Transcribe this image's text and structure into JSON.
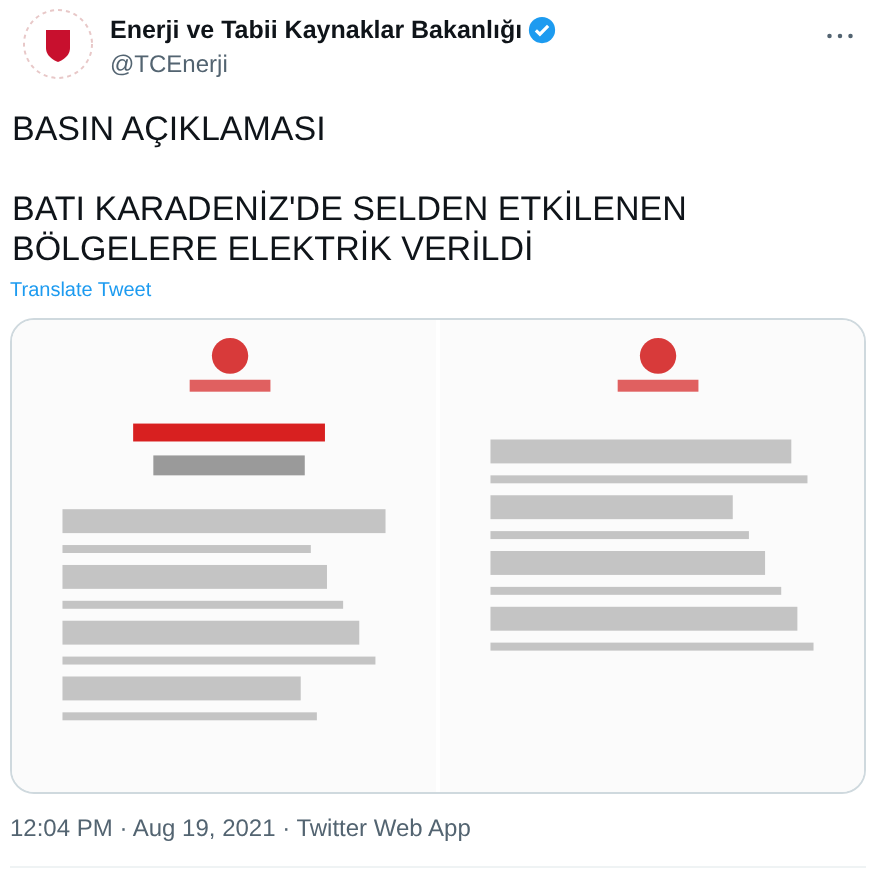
{
  "author": {
    "name": "Enerji ve Tabii Kaynaklar Bakanlığı",
    "verified": true,
    "handle": "@TCEnerji"
  },
  "tweet": {
    "paragraphs": [
      [
        "BASIN AÇIKLAMASI"
      ],
      [
        "BATI KARADENİZ'DE SELDEN ETKİLENEN",
        "BÖLGELERE ELEKTRİK VERİLDİ"
      ]
    ],
    "translate": "Translate Tweet"
  },
  "meta": "12:04 PM · Aug 19, 2021 · Twitter Web App"
}
